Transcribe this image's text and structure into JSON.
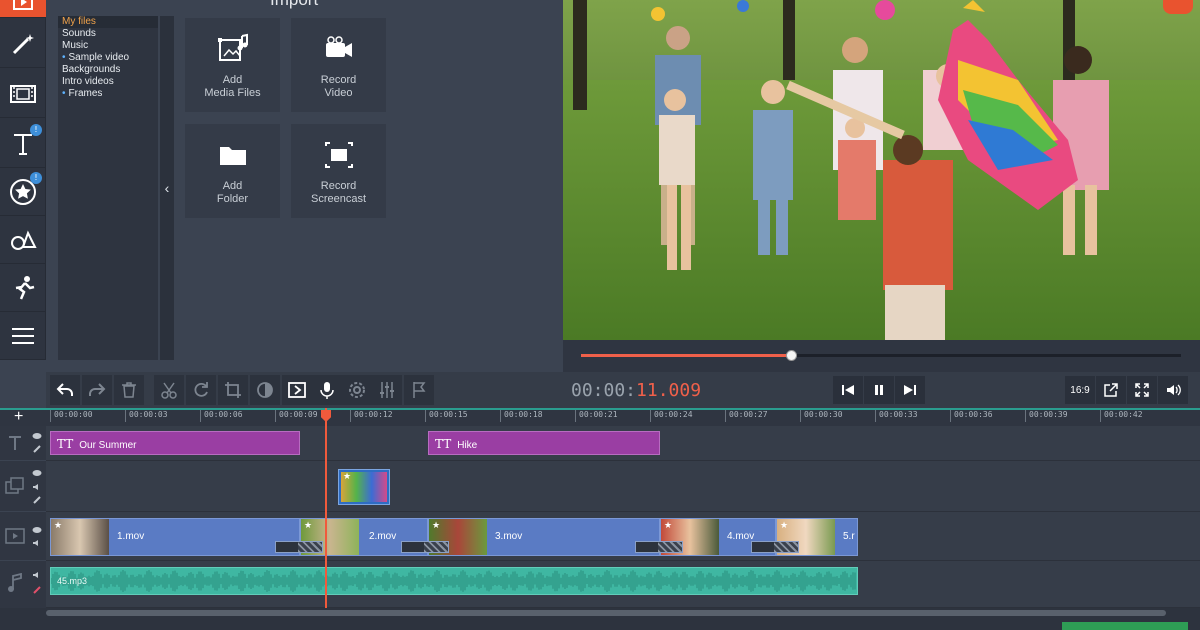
{
  "import": {
    "title": "Import",
    "categories": [
      {
        "label": "My files",
        "selected": true,
        "bullet": false
      },
      {
        "label": "Sounds",
        "selected": false,
        "bullet": false
      },
      {
        "label": "Music",
        "selected": false,
        "bullet": false
      },
      {
        "label": "Sample video",
        "selected": false,
        "bullet": true
      },
      {
        "label": "Backgrounds",
        "selected": false,
        "bullet": false
      },
      {
        "label": "Intro videos",
        "selected": false,
        "bullet": false
      },
      {
        "label": "Frames",
        "selected": false,
        "bullet": true
      }
    ],
    "tiles": [
      {
        "label": "Add\nMedia Files",
        "icon": "media-files-icon"
      },
      {
        "label": "Record\nVideo",
        "icon": "camera-icon"
      },
      {
        "label": "Add\nFolder",
        "icon": "folder-icon"
      },
      {
        "label": "Record\nScreencast",
        "icon": "screencast-icon"
      }
    ],
    "collapse_glyph": "‹"
  },
  "sidebar": {
    "badges": {
      "titles": "!",
      "stickers": "!"
    }
  },
  "player": {
    "progress": 0.35,
    "timecode_dim": "00:00:",
    "timecode_hot": "11.009",
    "aspect_label": "16:9"
  },
  "timeline": {
    "ruler": [
      "00:00:00",
      "00:00:03",
      "00:00:06",
      "00:00:09",
      "00:00:12",
      "00:00:15",
      "00:00:18",
      "00:00:21",
      "00:00:24",
      "00:00:27",
      "00:00:30",
      "00:00:33",
      "00:00:36",
      "00:00:39",
      "00:00:42"
    ],
    "add_glyph": "+",
    "titles": [
      {
        "label": "Our Summer"
      },
      {
        "label": "Hike"
      }
    ],
    "clips": [
      {
        "label": "1.mov"
      },
      {
        "label": "2.mov"
      },
      {
        "label": "3.mov"
      },
      {
        "label": "4.mov"
      },
      {
        "label": "5.r"
      }
    ],
    "audio": {
      "label": "45.mp3"
    },
    "tt_glyph": "TT"
  },
  "colors": {
    "accent": "#e9532f",
    "title_clip": "#9a3ea3",
    "video_clip": "#5a7bc4",
    "audio_clip": "#3fb7a2",
    "playhead": "#f05a3c"
  }
}
